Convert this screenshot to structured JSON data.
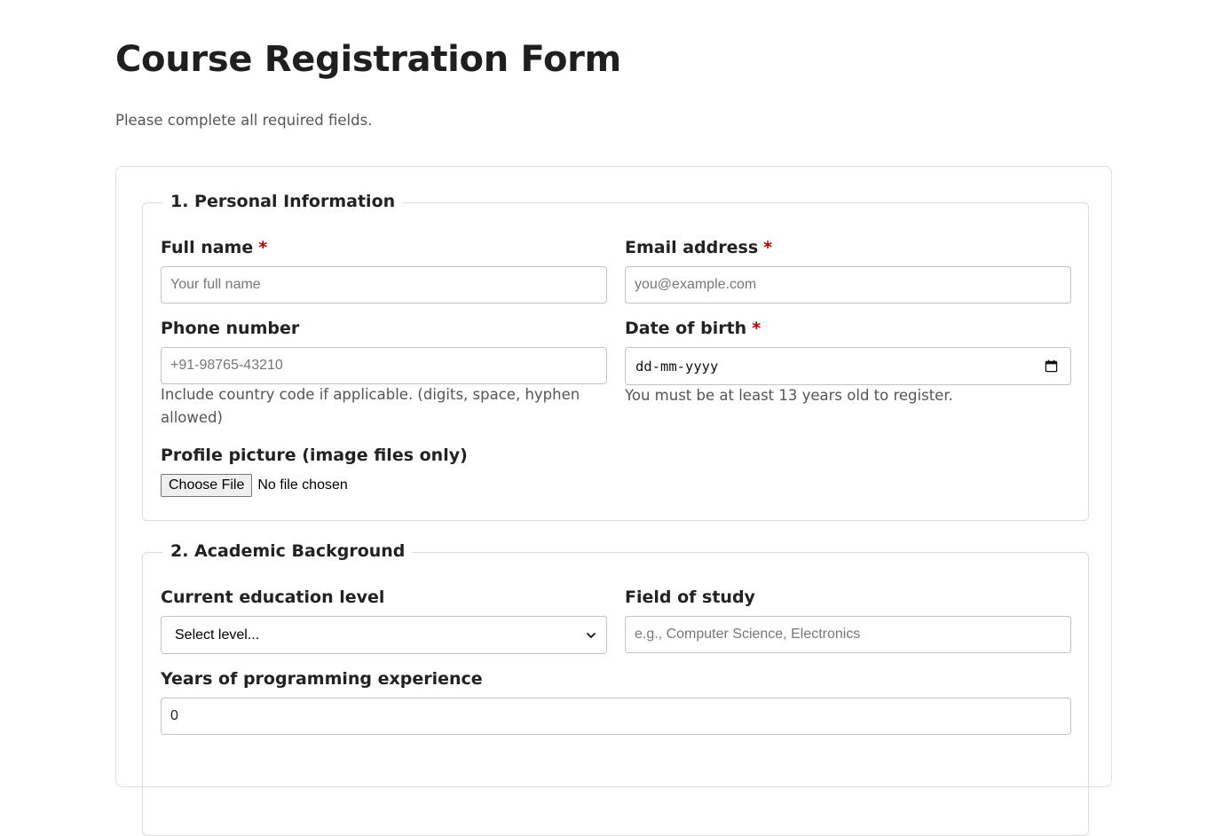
{
  "page": {
    "title": "Course Registration Form",
    "subtitle": "Please complete all required fields."
  },
  "personal": {
    "legend": "1. Personal Information",
    "full_name": {
      "label": "Full name",
      "required_mark": "*",
      "placeholder": "Your full name",
      "value": ""
    },
    "email": {
      "label": "Email address",
      "required_mark": "*",
      "placeholder": "you@example.com",
      "value": ""
    },
    "phone": {
      "label": "Phone number",
      "placeholder": "+91-98765-43210",
      "value": "",
      "help": "Include country code if applicable. (digits, space, hyphen allowed)"
    },
    "dob": {
      "label": "Date of birth",
      "required_mark": "*",
      "display": "dd-mm-yyyy",
      "help": "You must be at least 13 years old to register."
    },
    "profile_picture": {
      "label": "Profile picture (image files only)",
      "button_label": "Choose File",
      "status": "No file chosen"
    }
  },
  "academic": {
    "legend": "2. Academic Background",
    "education_level": {
      "label": "Current education level",
      "selected": "Select level..."
    },
    "field_of_study": {
      "label": "Field of study",
      "placeholder": "e.g., Computer Science, Electronics",
      "value": ""
    },
    "experience": {
      "label": "Years of programming experience",
      "value": "0"
    }
  },
  "colors": {
    "required": "#b00000",
    "border": "#c4c4c4",
    "help_text": "#555555"
  },
  "icons": {
    "date_picker": "calendar-icon",
    "select": "chevron-down-icon"
  }
}
